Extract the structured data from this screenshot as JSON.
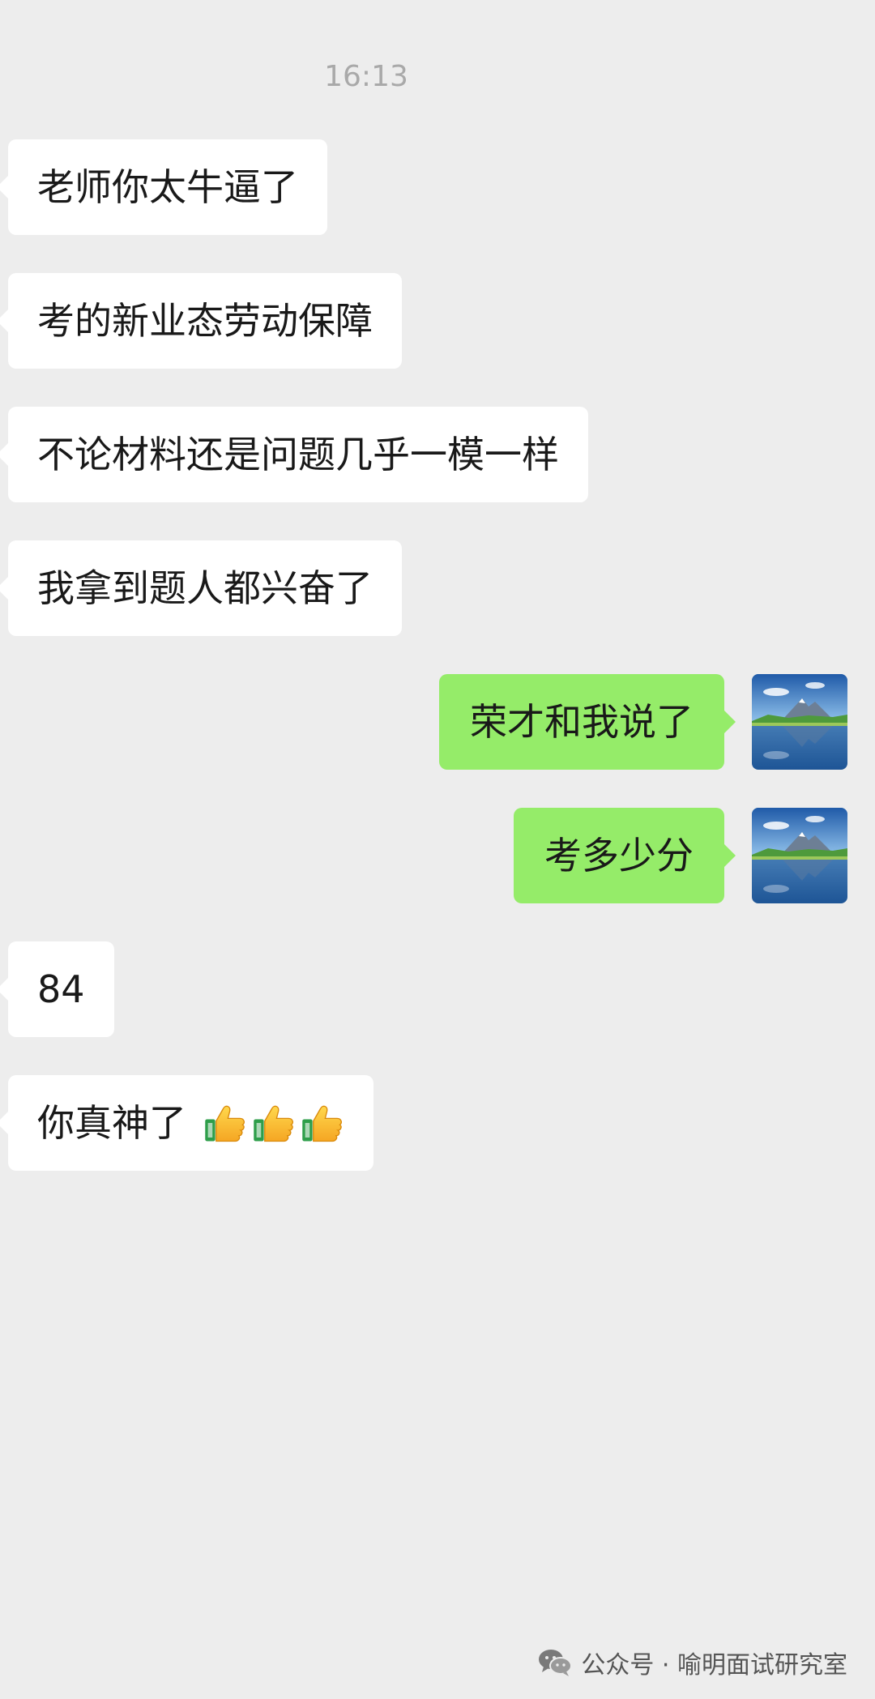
{
  "chat": {
    "timestamp": "16:13",
    "messages": [
      {
        "side": "left",
        "text": "老师你太牛逼了"
      },
      {
        "side": "left",
        "text": "考的新业态劳动保障"
      },
      {
        "side": "left",
        "text": "不论材料还是问题几乎一模一样"
      },
      {
        "side": "left",
        "text": "我拿到题人都兴奋了"
      },
      {
        "side": "right",
        "text": "荣才和我说了"
      },
      {
        "side": "right",
        "text": "考多少分"
      },
      {
        "side": "left",
        "text": "84"
      },
      {
        "side": "left",
        "text": "你真神了",
        "emoji": [
          "thumbs-up",
          "thumbs-up",
          "thumbs-up"
        ]
      }
    ]
  },
  "watermark": {
    "icon": "wechat-icon",
    "text": "公众号 · 喻明面试研究室"
  },
  "colors": {
    "background": "#ededed",
    "incoming_bubble": "#ffffff",
    "outgoing_bubble": "#95ec69",
    "timestamp": "#a9a9a9"
  }
}
